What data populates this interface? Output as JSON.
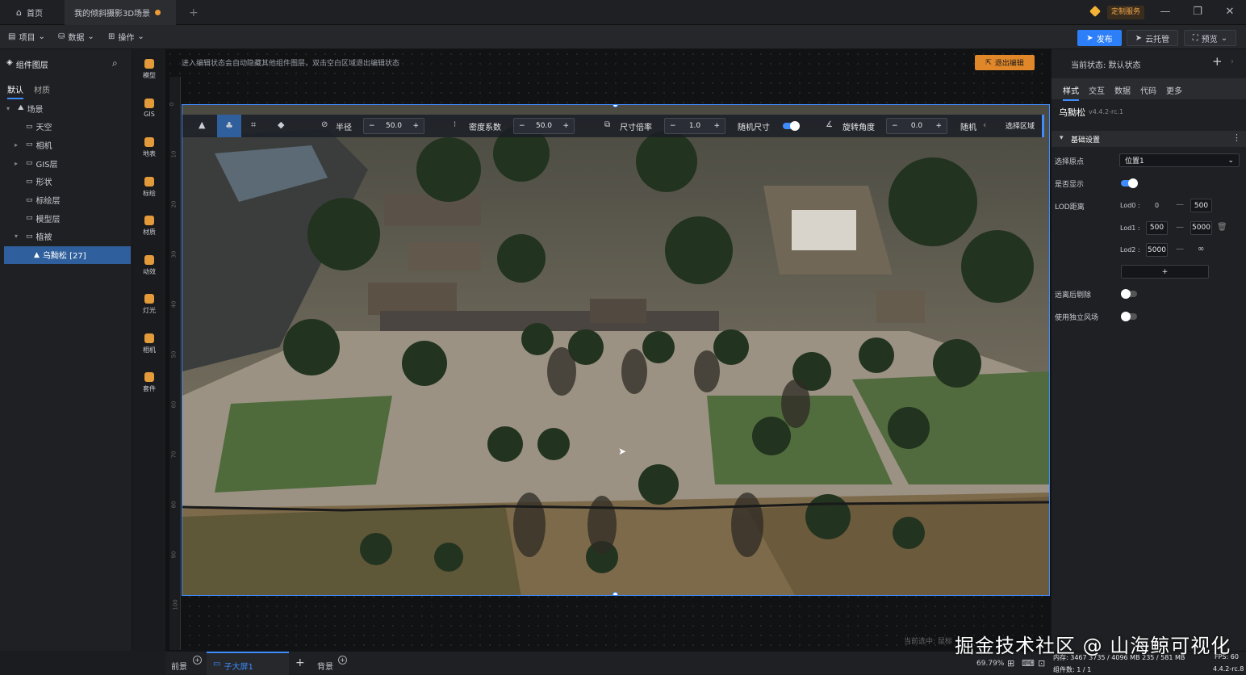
{
  "titlebar": {
    "home_tab": "首页",
    "project_tab": "我的倾斜摄影3D场景",
    "add_tab": "+",
    "custom_service": "定制服务",
    "min": "—",
    "restore": "❐",
    "close": "✕"
  },
  "menubar": {
    "project": "项目",
    "data": "数据",
    "operate": "操作",
    "publish": "发布",
    "cloud": "云托管",
    "preview": "预览"
  },
  "layers": {
    "title": "组件图层",
    "tabs": [
      "默认",
      "材质"
    ],
    "items": [
      {
        "label": "场景",
        "indent": 0,
        "arrow": "▾"
      },
      {
        "label": "天空",
        "indent": 1,
        "arrow": ""
      },
      {
        "label": "相机",
        "indent": 1,
        "arrow": "▸"
      },
      {
        "label": "GIS层",
        "indent": 1,
        "arrow": "▸"
      },
      {
        "label": "形状",
        "indent": 1,
        "arrow": ""
      },
      {
        "label": "标绘层",
        "indent": 1,
        "arrow": ""
      },
      {
        "label": "模型层",
        "indent": 1,
        "arrow": ""
      },
      {
        "label": "植被",
        "indent": 1,
        "arrow": "▾"
      },
      {
        "label": "乌黝松 [27]",
        "indent": 2,
        "arrow": "",
        "selected": true
      }
    ]
  },
  "rail": [
    {
      "label": "模型",
      "color": "#e39a3b"
    },
    {
      "label": "GIS",
      "color": "#e39a3b"
    },
    {
      "label": "地表",
      "color": "#e39a3b"
    },
    {
      "label": "标绘",
      "color": "#e39a3b"
    },
    {
      "label": "材质",
      "color": "#e39a3b"
    },
    {
      "label": "动效",
      "color": "#e39a3b"
    },
    {
      "label": "灯光",
      "color": "#e39a3b"
    },
    {
      "label": "相机",
      "color": "#e39a3b"
    },
    {
      "label": "套件",
      "color": "#e39a3b"
    }
  ],
  "canvas": {
    "hint": "进入编辑状态会自动隐藏其他组件图层，双击空白区域退出编辑状态",
    "exit_edit": "退出编辑",
    "ruler_ticks": [
      "0",
      "10",
      "20",
      "30",
      "40",
      "50",
      "60",
      "70",
      "80",
      "90",
      "100"
    ],
    "status_hint": "当前选中: 鼠标"
  },
  "toolbar3d": {
    "radius_label": "半径",
    "radius_value": "50.0",
    "density_label": "密度系数",
    "density_value": "50.0",
    "scale_label": "尺寸倍率",
    "scale_value": "1.0",
    "random_size_label": "随机尺寸",
    "rotate_label": "旋转角度",
    "rotate_value": "0.0",
    "random_label": "随机",
    "select_area": "选择区域",
    "minus": "−",
    "plus": "+"
  },
  "bottombar": {
    "foreground": "前景",
    "child_screen": "子大屏1",
    "add": "+",
    "background": "背景"
  },
  "rightpanel": {
    "state": "当前状态: 默认状态",
    "tabs": [
      "样式",
      "交互",
      "数据",
      "代码",
      "更多"
    ],
    "component_name": "乌黝松",
    "version": "v4.4.2-rc.1",
    "section": "基础设置",
    "origin_label": "选择原点",
    "origin_value": "位置1",
    "visible_label": "是否显示",
    "lod_label": "LOD距离",
    "lod": [
      {
        "name": "Lod0 :",
        "from": "0",
        "to": "500"
      },
      {
        "name": "Lod1 :",
        "from": "500",
        "to": "5000"
      },
      {
        "name": "Lod2 :",
        "from": "5000",
        "to": "∞"
      }
    ],
    "lod_add": "+",
    "far_remove_label": "远离后剔除",
    "wind_label": "使用独立风场"
  },
  "statusbar": {
    "memory": "内存: 3467 3735 / 4096 MB  235 / 581 MB",
    "fps": "FPS: 60",
    "components": "组件数: 1 / 1",
    "version": "4.4.2-rc.8",
    "zoom": "69.79%"
  },
  "watermark": "掘金技术社区 @ 山海鲸可视化",
  "colors": {
    "accent": "#3f8cff",
    "orange": "#f09a36",
    "publish": "#2d7ff9"
  }
}
